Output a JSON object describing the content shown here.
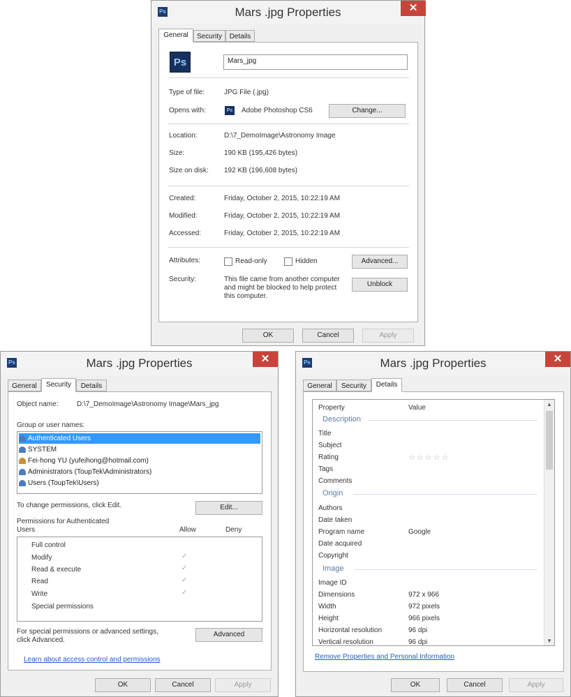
{
  "general_dialog": {
    "app_icon": "photoshop-icon",
    "title": "Mars .jpg Properties",
    "tabs": [
      "General",
      "Security",
      "Details"
    ],
    "file_icon_text": "Ps",
    "filename": "Mars_jpg",
    "type_label": "Type of file:",
    "type_value": "JPG File (.jpg)",
    "opens_label": "Opens with:",
    "opens_icon_text": "Ps",
    "opens_value": "Adobe Photoshop CS6",
    "change_button": "Change...",
    "location_label": "Location:",
    "location_value": "D:\\7_DemoImage\\Astronomy Image",
    "size_label": "Size:",
    "size_value": "190 KB (195,426 bytes)",
    "size_disk_label": "Size on disk:",
    "size_disk_value": "192 KB (196,608 bytes)",
    "created_label": "Created:",
    "created_value": "Friday, October 2, 2015, 10:22:19 AM",
    "modified_label": "Modified:",
    "modified_value": "Friday, October 2, 2015, 10:22:19 AM",
    "accessed_label": "Accessed:",
    "accessed_value": "Friday, October 2, 2015, 10:22:19 AM",
    "attributes_label": "Attributes:",
    "readonly_label": "Read-only",
    "hidden_label": "Hidden",
    "advanced_button": "Advanced...",
    "security_label": "Security:",
    "security_line1": "This file came from another computer",
    "security_line2": "and might be blocked to help protect",
    "security_line3": "this computer.",
    "unblock_button": "Unblock",
    "ok_button": "OK",
    "cancel_button": "Cancel",
    "apply_button": "Apply"
  },
  "security_dialog": {
    "title": "Mars .jpg Properties",
    "tabs": [
      "General",
      "Security",
      "Details"
    ],
    "object_label": "Object name:",
    "object_value": "D:\\7_DemoImage\\Astronomy Image\\Mars_jpg",
    "group_label": "Group or user names:",
    "users": [
      "Authenticated Users",
      "SYSTEM",
      "Fei-hong YU (yufeihong@hotmail.com)",
      "Administrators (ToupTek\\Administrators)",
      "Users (ToupTek\\Users)"
    ],
    "change_perm_text": "To change permissions, click Edit.",
    "edit_button": "Edit...",
    "perm_for_line1": "Permissions for Authenticated",
    "perm_for_line2": "Users",
    "allow_header": "Allow",
    "deny_header": "Deny",
    "permissions": [
      "Full control",
      "Modify",
      "Read & execute",
      "Read",
      "Write",
      "Special permissions"
    ],
    "allow_checks": [
      false,
      true,
      true,
      true,
      true,
      false
    ],
    "special_line1": "For special permissions or advanced settings,",
    "special_line2": "click Advanced.",
    "advanced_button": "Advanced",
    "learn_link": "Learn about access control and permissions",
    "ok_button": "OK",
    "cancel_button": "Cancel",
    "apply_button": "Apply"
  },
  "details_dialog": {
    "title": "Mars .jpg Properties",
    "tabs": [
      "General",
      "Security",
      "Details"
    ],
    "col_property": "Property",
    "col_value": "Value",
    "groups": {
      "description": "Description",
      "origin": "Origin",
      "image": "Image"
    },
    "description_rows": [
      "Title",
      "Subject",
      "Rating",
      "Tags",
      "Comments"
    ],
    "rating_stars": "☆☆☆☆☆",
    "origin_rows": [
      "Authors",
      "Date taken",
      "Program name",
      "Date acquired",
      "Copyright"
    ],
    "program_name_value": "Google",
    "image_rows": [
      "Image ID",
      "Dimensions",
      "Width",
      "Height",
      "Horizontal resolution",
      "Vertical resolution"
    ],
    "image_values": [
      "",
      "972 x 966",
      "972 pixels",
      "966 pixels",
      "96 dpi",
      "96 dpi"
    ],
    "remove_link": "Remove Properties and Personal Information",
    "ok_button": "OK",
    "cancel_button": "Cancel",
    "apply_button": "Apply"
  }
}
